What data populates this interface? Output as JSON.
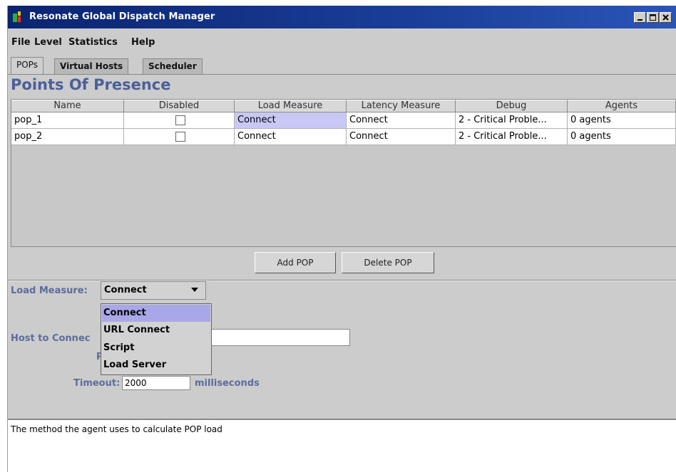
{
  "window": {
    "title": "Resonate Global Dispatch Manager"
  },
  "menubar": {
    "items": [
      "File",
      "Level",
      "Statistics",
      "Help"
    ]
  },
  "tabs": [
    {
      "label": "POPs",
      "active": true
    },
    {
      "label": "Virtual Hosts",
      "active": false
    },
    {
      "label": "Scheduler",
      "active": false
    }
  ],
  "section_title": "Points Of Presence",
  "table": {
    "columns": [
      "Name",
      "Disabled",
      "Load Measure",
      "Latency Measure",
      "Debug",
      "Agents"
    ],
    "rows": [
      {
        "name": "pop_1",
        "disabled": false,
        "load": "Connect",
        "latency": "Connect",
        "debug": "2 - Critical Proble...",
        "agents": "0 agents"
      },
      {
        "name": "pop_2",
        "disabled": false,
        "load": "Connect",
        "latency": "Connect",
        "debug": "2 - Critical Proble...",
        "agents": "0 agents"
      }
    ]
  },
  "buttons": {
    "add": "Add POP",
    "delete": "Delete POP"
  },
  "form": {
    "load_measure_label": "Load Measure:",
    "load_measure_value": "Connect",
    "options": [
      "Connect",
      "URL Connect",
      "Script",
      "Load Server"
    ],
    "host_label": "Host to Connec",
    "port_label_fragment": "P",
    "timeout_label": "Timeout:",
    "timeout_value": "2000",
    "timeout_unit": "milliseconds"
  },
  "description": "The method the agent uses to calculate POP load",
  "colors": {
    "titlebar": "#0a2470",
    "selection": "#c8c8f4",
    "label_blue": "#5a6d9c"
  }
}
